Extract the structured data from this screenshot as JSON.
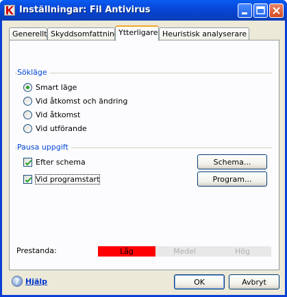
{
  "window": {
    "title": "Inställningar: Fil Antivirus"
  },
  "title_buttons": {
    "minimize_icon": "minimize-icon",
    "maximize_icon": "maximize-icon",
    "close_icon": "close-icon"
  },
  "tabs": [
    {
      "label": "Generellt",
      "active": false
    },
    {
      "label": "Skyddsomfattning",
      "active": false
    },
    {
      "label": "Ytterligare",
      "active": true
    },
    {
      "label": "Heuristisk analyserare",
      "active": false
    }
  ],
  "scan_mode": {
    "label": "Sökläge",
    "options": [
      {
        "label": "Smart läge",
        "selected": true
      },
      {
        "label": "Vid åtkomst och ändring",
        "selected": false
      },
      {
        "label": "Vid åtkomst",
        "selected": false
      },
      {
        "label": "Vid utförande",
        "selected": false
      }
    ]
  },
  "pause_task": {
    "label": "Pausa uppgift",
    "options": [
      {
        "label": "Efter schema",
        "checked": true,
        "button": "Schema..."
      },
      {
        "label": "Vid programstart",
        "checked": true,
        "button": "Program..."
      }
    ]
  },
  "performance": {
    "label": "Prestanda:",
    "levels": [
      "Låg",
      "Medel",
      "Hög"
    ],
    "selected": "Låg",
    "active_color": "#ff0000",
    "inactive_color": "#e8e8e8"
  },
  "footer": {
    "help_label": "Hjälp",
    "ok_label": "OK",
    "cancel_label": "Avbryt"
  },
  "colors": {
    "titlebar": "#0a5cf2",
    "group_label": "#0046d5",
    "radio_dot": "#21a121"
  }
}
